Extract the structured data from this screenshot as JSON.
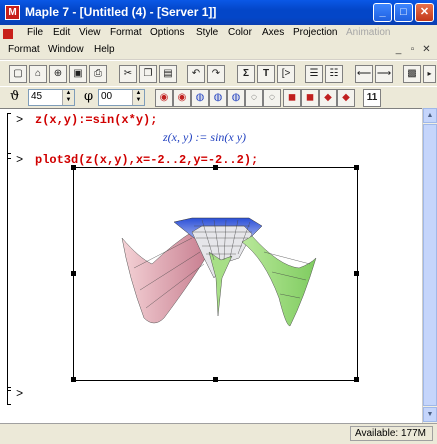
{
  "window": {
    "title": "Maple 7 - [Untitled (4) - [Server 1]]",
    "app_icon": "maple-leaf-icon",
    "controls": [
      "_",
      "□",
      "✕"
    ]
  },
  "menu": {
    "row1": [
      "File",
      "Edit",
      "View",
      "Format",
      "Options",
      "Style",
      "Color",
      "Axes",
      "Projection",
      "Animation"
    ],
    "row2": [
      "Format",
      "Window",
      "Help"
    ],
    "disabled": [
      "Animation"
    ]
  },
  "rotation": {
    "theta_symbol": "ϑ",
    "theta_value": "45",
    "phi_symbol": "φ",
    "phi_value": "00"
  },
  "worksheet": {
    "prompt": ">",
    "input1": "z(x,y):=sin(x*y);",
    "output1": "z(x, y) := sin(x y)",
    "input2": "plot3d(z(x,y),x=-2..2,y=-2..2);",
    "empty_prompt": ">"
  },
  "plot": {
    "type": "surface-3d",
    "function": "sin(x*y)",
    "x_range": [
      -2,
      2
    ],
    "y_range": [
      -2,
      2
    ]
  },
  "status": {
    "available": "Available: 177M"
  }
}
